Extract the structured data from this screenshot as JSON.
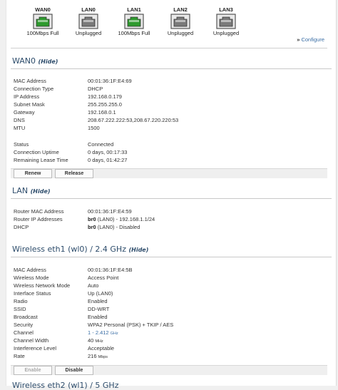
{
  "ports": [
    {
      "name": "WAN0",
      "status": "100Mbps Full",
      "connected": true
    },
    {
      "name": "LAN0",
      "status": "Unplugged",
      "connected": false
    },
    {
      "name": "LAN1",
      "status": "100Mbps Full",
      "connected": true
    },
    {
      "name": "LAN2",
      "status": "Unplugged",
      "connected": false
    },
    {
      "name": "LAN3",
      "status": "Unplugged",
      "connected": false
    }
  ],
  "colors": {
    "connected": "#2e9a2e",
    "unplugged": "#7a7a7a",
    "heading": "#2d4c6b",
    "link": "#3a6ea5"
  },
  "configure_link": "Configure",
  "hide_label": "(Hide)",
  "wan": {
    "title": "WAN0",
    "rows": [
      {
        "label": "MAC Address",
        "value": "00:01:36:1F:E4:69"
      },
      {
        "label": "Connection Type",
        "value": "DHCP"
      },
      {
        "label": "IP Address",
        "value": "192.168.0.179"
      },
      {
        "label": "Subnet Mask",
        "value": "255.255.255.0"
      },
      {
        "label": "Gateway",
        "value": "192.168.0.1"
      },
      {
        "label": "DNS",
        "value": "208.67.222.222:53,208.67.220.220:53"
      },
      {
        "label": "MTU",
        "value": "1500"
      }
    ],
    "status_rows": [
      {
        "label": "Status",
        "value": "Connected"
      },
      {
        "label": "Connection Uptime",
        "value": "0 days, 00:17:33"
      },
      {
        "label": "Remaining Lease Time",
        "value": "0 days, 01:42:27"
      }
    ],
    "renew_label": "Renew",
    "release_label": "Release"
  },
  "lan": {
    "title": "LAN",
    "rows": [
      {
        "label": "Router MAC Address",
        "value": "00:01:36:1F:E4:59"
      },
      {
        "label": "Router IP Addresses",
        "bold": "br0",
        "value": " (LAN0) - 192.168.1.1/24"
      },
      {
        "label": "DHCP",
        "bold": "br0",
        "value": " (LAN0) - Disabled"
      }
    ]
  },
  "wireless": {
    "title": "Wireless eth1 (wl0) / 2.4 GHz",
    "rows": [
      {
        "label": "MAC Address",
        "value": "00:01:36:1F:E4:5B"
      },
      {
        "label": "Wireless Mode",
        "value": "Access Point"
      },
      {
        "label": "Wireless Network Mode",
        "value": "Auto"
      },
      {
        "label": "Interface Status",
        "value": "Up (LAN0)"
      },
      {
        "label": "Radio",
        "value": "Enabled"
      },
      {
        "label": "SSID",
        "value": "DD-WRT"
      },
      {
        "label": "Broadcast",
        "value": "Enabled"
      },
      {
        "label": "Security",
        "value": "WPA2 Personal (PSK) + TKIP / AES"
      },
      {
        "label": "Channel",
        "link": "1 - 2.412",
        "unit": "GHz"
      },
      {
        "label": "Channel Width",
        "value": "40",
        "unit": "MHz"
      },
      {
        "label": "Interference Level",
        "value": "Acceptable"
      },
      {
        "label": "Rate",
        "value": "216",
        "unit": "Mbps"
      }
    ],
    "enable_label": "Enable",
    "disable_label": "Disable"
  },
  "next_section_title": "Wireless eth2 (wl1) / 5 GHz"
}
